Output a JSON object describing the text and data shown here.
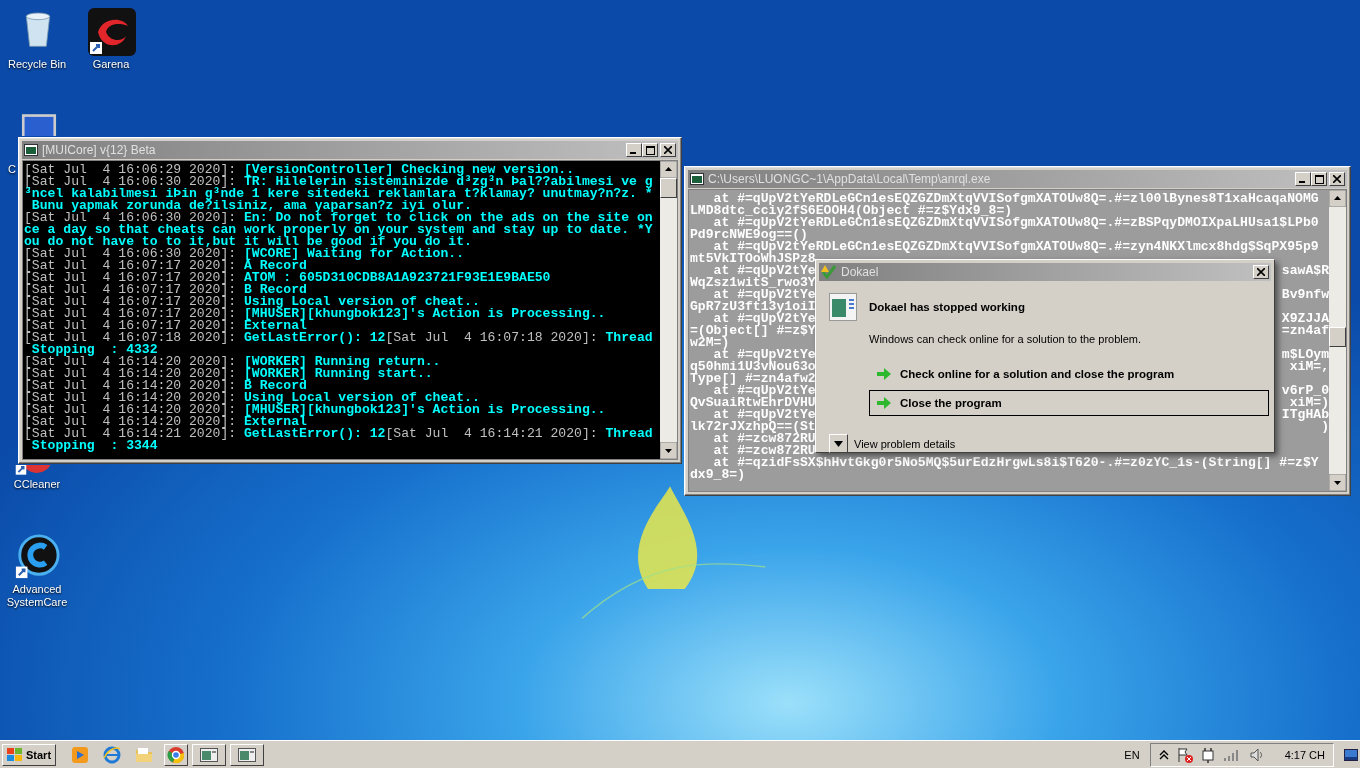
{
  "desktop_icons": [
    {
      "label": "Recycle Bin",
      "kind": "recycle"
    },
    {
      "label": "Garena",
      "kind": "garena"
    },
    {
      "label": "C",
      "kind": "computer"
    },
    {
      "label": "CCleaner",
      "kind": "ccleaner"
    },
    {
      "label": "Advanced SystemCare",
      "kind": "systemcare"
    }
  ],
  "console_window": {
    "title": "[MUICore] v{12} Beta",
    "rows": [
      [
        {
          "kind": "stamp",
          "text": "[Sat Jul  4 16:06:29 2020]: "
        },
        {
          "kind": "message",
          "text": "[VersionController] Checking new version.."
        }
      ],
      [
        {
          "kind": "stamp",
          "text": "[Sat Jul  4 16:06:30 2020]: "
        },
        {
          "kind": "message",
          "text": "TR: Hilelerin sisteminizde d³zg³n Þal??abilmesi ve g"
        }
      ],
      [
        {
          "kind": "message",
          "text": "³ncel kalabilmesi iÞin g³nde 1 kere sitedeki reklamlara t?klamay? unutmay?n?z. *"
        }
      ],
      [
        {
          "kind": "message",
          "text": " Bunu yapmak zorunda de?ilsiniz, ama yaparsan?z iyi olur."
        }
      ],
      [
        {
          "kind": "stamp",
          "text": "[Sat Jul  4 16:06:30 2020]: "
        },
        {
          "kind": "message",
          "text": "En: Do not forget to click on the ads on the site on"
        }
      ],
      [
        {
          "kind": "message",
          "text": "ce a day so that cheats can work properly on your system and stay up to date. *Y"
        }
      ],
      [
        {
          "kind": "message",
          "text": "ou do not have to to it,but it will be good if you do it."
        }
      ],
      [
        {
          "kind": "stamp",
          "text": "[Sat Jul  4 16:06:30 2020]: "
        },
        {
          "kind": "message",
          "text": "[WCORE] Waiting for Action.."
        }
      ],
      [
        {
          "kind": "stamp",
          "text": "[Sat Jul  4 16:07:17 2020]: "
        },
        {
          "kind": "message",
          "text": "A Record"
        }
      ],
      [
        {
          "kind": "stamp",
          "text": "[Sat Jul  4 16:07:17 2020]: "
        },
        {
          "kind": "message",
          "text": "ATOM : 605D310CDB8A1A923721F93E1E9BAE50"
        }
      ],
      [
        {
          "kind": "stamp",
          "text": "[Sat Jul  4 16:07:17 2020]: "
        },
        {
          "kind": "message",
          "text": "B Record"
        }
      ],
      [
        {
          "kind": "stamp",
          "text": "[Sat Jul  4 16:07:17 2020]: "
        },
        {
          "kind": "message",
          "text": "Using Local version of cheat.."
        }
      ],
      [
        {
          "kind": "stamp",
          "text": "[Sat Jul  4 16:07:17 2020]: "
        },
        {
          "kind": "message",
          "text": "[MHUSER][khungbok123]'s Action is Processing.."
        }
      ],
      [
        {
          "kind": "stamp",
          "text": "[Sat Jul  4 16:07:17 2020]: "
        },
        {
          "kind": "message",
          "text": "External"
        }
      ],
      [
        {
          "kind": "stamp",
          "text": "[Sat Jul  4 16:07:18 2020]: "
        },
        {
          "kind": "message",
          "text": "GetLastError(): 12"
        },
        {
          "kind": "stamp",
          "text": "[Sat Jul  4 16:07:18 2020]: "
        },
        {
          "kind": "message",
          "text": "Thread"
        }
      ],
      [
        {
          "kind": "message",
          "text": " Stopping  : 4332"
        }
      ],
      [
        {
          "kind": "stamp",
          "text": "[Sat Jul  4 16:14:20 2020]: "
        },
        {
          "kind": "message",
          "text": "[WORKER] Running return.."
        }
      ],
      [
        {
          "kind": "stamp",
          "text": "[Sat Jul  4 16:14:20 2020]: "
        },
        {
          "kind": "message",
          "text": "[WORKER] Running start.."
        }
      ],
      [
        {
          "kind": "stamp",
          "text": "[Sat Jul  4 16:14:20 2020]: "
        },
        {
          "kind": "message",
          "text": "B Record"
        }
      ],
      [
        {
          "kind": "stamp",
          "text": "[Sat Jul  4 16:14:20 2020]: "
        },
        {
          "kind": "message",
          "text": "Using Local version of cheat.."
        }
      ],
      [
        {
          "kind": "stamp",
          "text": "[Sat Jul  4 16:14:20 2020]: "
        },
        {
          "kind": "message",
          "text": "[MHUSER][khungbok123]'s Action is Processing.."
        }
      ],
      [
        {
          "kind": "stamp",
          "text": "[Sat Jul  4 16:14:20 2020]: "
        },
        {
          "kind": "message",
          "text": "External"
        }
      ],
      [
        {
          "kind": "stamp",
          "text": "[Sat Jul  4 16:14:21 2020]: "
        },
        {
          "kind": "message",
          "text": "GetLastError(): 12"
        },
        {
          "kind": "stamp",
          "text": "[Sat Jul  4 16:14:21 2020]: "
        },
        {
          "kind": "message",
          "text": "Thread"
        }
      ],
      [
        {
          "kind": "message",
          "text": " Stopping  : 3344"
        }
      ]
    ]
  },
  "output_window": {
    "title": "C:\\Users\\LUONGC~1\\AppData\\Local\\Temp\\anrql.exe",
    "rows": [
      {
        "left": "   at #=qUpV2tYeRDLeGCn1esEQZGZDmXtqVVISofgmXATOUw8Q=.#=zl00lBynes8T1xaHcaqaNOMG"
      },
      {
        "left": "LMD8dtc_cciy2fS6EOOH4(Object #=z$Ydx9_8=)"
      },
      {
        "left": "   at #=qUpV2tYeRDLeGCn1esEQZGZDmXtqVVISofgmXATOUw8Q=.#=zBSPqyDMOIXpaLHUsa1$LPb0"
      },
      {
        "left": "Pd9rcNWE9og==()"
      },
      {
        "left": "   at #=qUpV2tYeRDLeGCn1esEQZGZDmXtqVVISofgmXATOUw8Q=.#=zyn4NKXlmcx8hdg$SqPX95p9"
      },
      {
        "left": "mt5VkITOoWhJSPz8"
      },
      {
        "left": "   at #=qUpV2tYe",
        "right": "sawA$R"
      },
      {
        "left": "WqZsz1witS_rwo3Y"
      },
      {
        "left": "   at #=qUpV2tYe",
        "right": "Bv9nfw"
      },
      {
        "left": "GpR7zU3ft13y1oiI"
      },
      {
        "left": "   at #=qUpV2tYe",
        "right": "X9ZJJA"
      },
      {
        "left": "=(Object[] #=z$Y",
        "right": "=zn4af"
      },
      {
        "left": "w2M=)"
      },
      {
        "left": "   at #=qUpV2tYe",
        "right": "m$LOym"
      },
      {
        "left": "q50hmi1U3vNou63o",
        "right": "xiM=,"
      },
      {
        "left": "Type[] #=zn4afw2"
      },
      {
        "left": "   at #=qUpV2tYe",
        "right": "v6rP_0"
      },
      {
        "left": "QvSuaiRtwEhrDVHU",
        "right": "xiM=)"
      },
      {
        "left": "   at #=qUpV2tYe",
        "right": "ITgHAb"
      },
      {
        "left": "lk72rJXzhpQ==(St",
        "right": ")"
      },
      {
        "left": "   at #=zcw872RU"
      },
      {
        "left": "   at #=zcw872RU"
      },
      {
        "left": "   at #=qzidFsSX$hHvtGkg0r5No5MQ$5urEdzHrgwLs8i$T620-.#=z0zYC_1s-(String[] #=z$Y"
      },
      {
        "left": "dx9_8=)"
      }
    ]
  },
  "error_dialog": {
    "title": "Dokael",
    "heading": "Dokael has stopped working",
    "message": "Windows can check online for a solution to the problem.",
    "options": [
      {
        "label": "Check online for a solution and close the program",
        "selected": false
      },
      {
        "label": "Close the program",
        "selected": true
      }
    ],
    "details_label": "View problem details"
  },
  "taskbar": {
    "start_label": "Start",
    "items": [
      {
        "kind": "media"
      },
      {
        "kind": "browser-e"
      },
      {
        "kind": "folder"
      },
      {
        "kind": "chrome"
      },
      {
        "kind": "console"
      },
      {
        "kind": "console"
      }
    ],
    "language": "EN",
    "clock": "4:17 CH"
  }
}
